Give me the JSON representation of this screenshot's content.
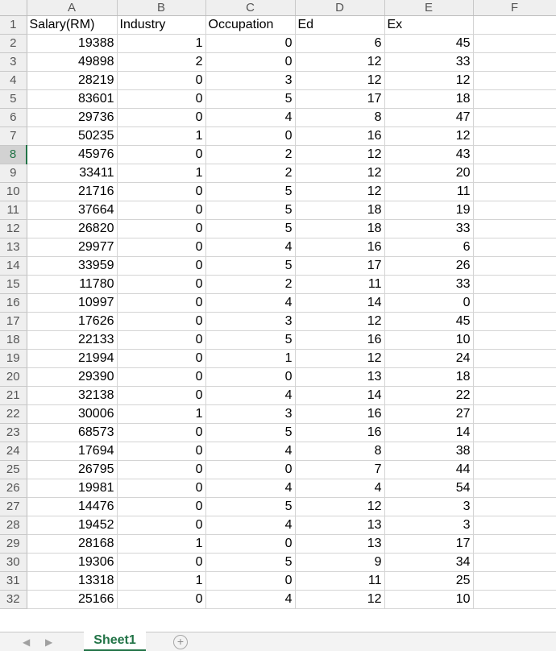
{
  "sheet": {
    "column_letters": [
      "A",
      "B",
      "C",
      "D",
      "E",
      "F"
    ],
    "active_row": "8",
    "rows": [
      {
        "num": "1",
        "cells": [
          "Salary(RM)",
          "Industry",
          "Occupation",
          "Ed",
          "Ex",
          ""
        ]
      },
      {
        "num": "2",
        "cells": [
          "19388",
          "1",
          "0",
          "6",
          "45",
          ""
        ]
      },
      {
        "num": "3",
        "cells": [
          "49898",
          "2",
          "0",
          "12",
          "33",
          ""
        ]
      },
      {
        "num": "4",
        "cells": [
          "28219",
          "0",
          "3",
          "12",
          "12",
          ""
        ]
      },
      {
        "num": "5",
        "cells": [
          "83601",
          "0",
          "5",
          "17",
          "18",
          ""
        ]
      },
      {
        "num": "6",
        "cells": [
          "29736",
          "0",
          "4",
          "8",
          "47",
          ""
        ]
      },
      {
        "num": "7",
        "cells": [
          "50235",
          "1",
          "0",
          "16",
          "12",
          ""
        ]
      },
      {
        "num": "8",
        "cells": [
          "45976",
          "0",
          "2",
          "12",
          "43",
          ""
        ]
      },
      {
        "num": "9",
        "cells": [
          "33411",
          "1",
          "2",
          "12",
          "20",
          ""
        ]
      },
      {
        "num": "10",
        "cells": [
          "21716",
          "0",
          "5",
          "12",
          "11",
          ""
        ]
      },
      {
        "num": "11",
        "cells": [
          "37664",
          "0",
          "5",
          "18",
          "19",
          ""
        ]
      },
      {
        "num": "12",
        "cells": [
          "26820",
          "0",
          "5",
          "18",
          "33",
          ""
        ]
      },
      {
        "num": "13",
        "cells": [
          "29977",
          "0",
          "4",
          "16",
          "6",
          ""
        ]
      },
      {
        "num": "14",
        "cells": [
          "33959",
          "0",
          "5",
          "17",
          "26",
          ""
        ]
      },
      {
        "num": "15",
        "cells": [
          "11780",
          "0",
          "2",
          "11",
          "33",
          ""
        ]
      },
      {
        "num": "16",
        "cells": [
          "10997",
          "0",
          "4",
          "14",
          "0",
          ""
        ]
      },
      {
        "num": "17",
        "cells": [
          "17626",
          "0",
          "3",
          "12",
          "45",
          ""
        ]
      },
      {
        "num": "18",
        "cells": [
          "22133",
          "0",
          "5",
          "16",
          "10",
          ""
        ]
      },
      {
        "num": "19",
        "cells": [
          "21994",
          "0",
          "1",
          "12",
          "24",
          ""
        ]
      },
      {
        "num": "20",
        "cells": [
          "29390",
          "0",
          "0",
          "13",
          "18",
          ""
        ]
      },
      {
        "num": "21",
        "cells": [
          "32138",
          "0",
          "4",
          "14",
          "22",
          ""
        ]
      },
      {
        "num": "22",
        "cells": [
          "30006",
          "1",
          "3",
          "16",
          "27",
          ""
        ]
      },
      {
        "num": "23",
        "cells": [
          "68573",
          "0",
          "5",
          "16",
          "14",
          ""
        ]
      },
      {
        "num": "24",
        "cells": [
          "17694",
          "0",
          "4",
          "8",
          "38",
          ""
        ]
      },
      {
        "num": "25",
        "cells": [
          "26795",
          "0",
          "0",
          "7",
          "44",
          ""
        ]
      },
      {
        "num": "26",
        "cells": [
          "19981",
          "0",
          "4",
          "4",
          "54",
          ""
        ]
      },
      {
        "num": "27",
        "cells": [
          "14476",
          "0",
          "5",
          "12",
          "3",
          ""
        ]
      },
      {
        "num": "28",
        "cells": [
          "19452",
          "0",
          "4",
          "13",
          "3",
          ""
        ]
      },
      {
        "num": "29",
        "cells": [
          "28168",
          "1",
          "0",
          "13",
          "17",
          ""
        ]
      },
      {
        "num": "30",
        "cells": [
          "19306",
          "0",
          "5",
          "9",
          "34",
          ""
        ]
      },
      {
        "num": "31",
        "cells": [
          "13318",
          "1",
          "0",
          "11",
          "25",
          ""
        ]
      },
      {
        "num": "32",
        "cells": [
          "25166",
          "0",
          "4",
          "12",
          "10",
          ""
        ]
      }
    ]
  },
  "tabs": {
    "prev_icon": "◀",
    "next_icon": "▶",
    "active_sheet": "Sheet1",
    "add_icon": "+"
  },
  "colors": {
    "accent": "#217346",
    "header_bg": "#efefef",
    "gridline": "#d4d4d4"
  }
}
